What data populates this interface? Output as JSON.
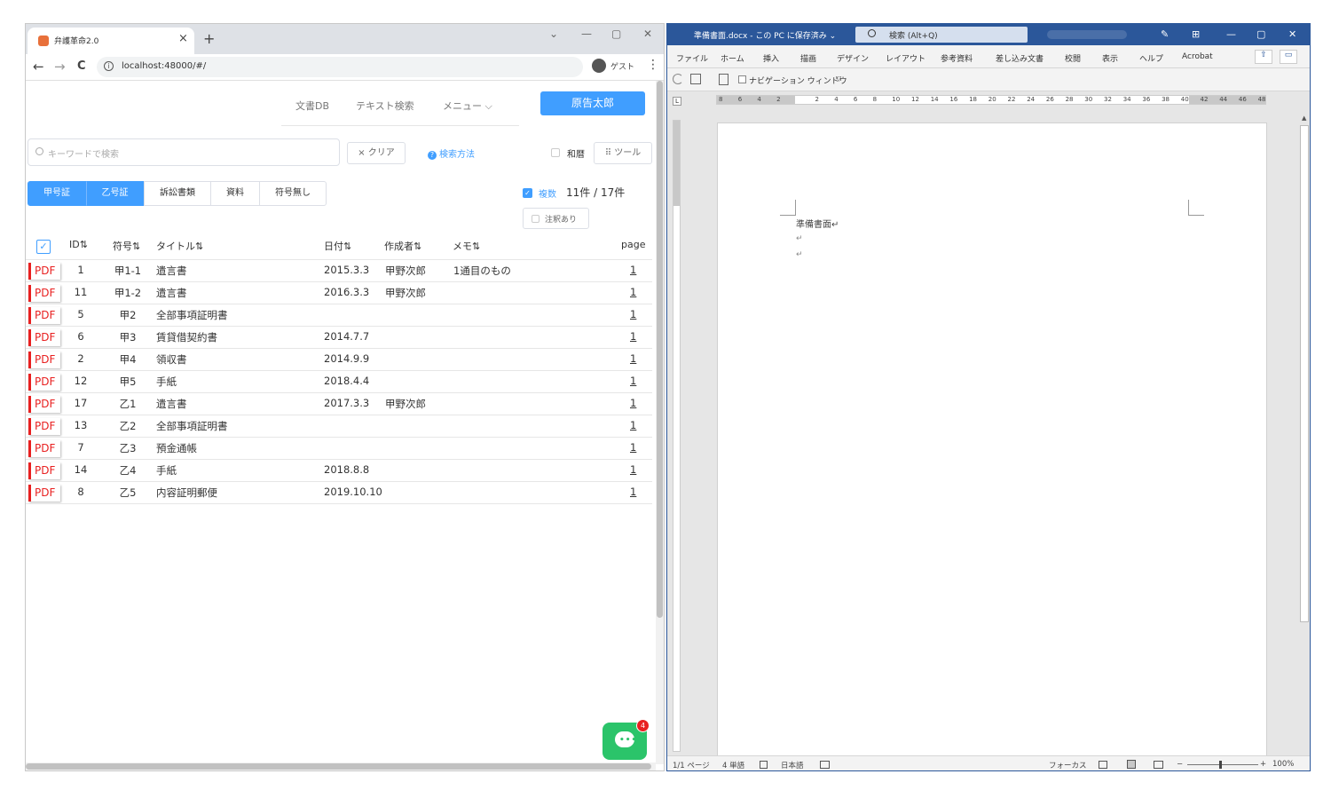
{
  "browser": {
    "tab_title": "弁護革命2.0",
    "url": "localhost:48000/#/",
    "profile_label": "ゲスト",
    "tab_close": "×",
    "new_tab": "+",
    "back": "←",
    "forward": "→",
    "reload": "C",
    "kebab": "⋮",
    "win_controls": [
      "⌄",
      "—",
      "▢",
      "✕"
    ]
  },
  "app": {
    "nav": [
      "文書DB",
      "テキスト検索",
      "メニュー ⌵"
    ],
    "user_button": "原告太郎",
    "search_placeholder": "キーワードで検索",
    "clear_label": "× クリア",
    "help_label": "検索方法",
    "wareki_label": "和暦",
    "tool_label": "⠿ ツール",
    "categories": [
      "甲号証",
      "乙号証",
      "訴訟書類",
      "資料",
      "符号無し"
    ],
    "multi_label": "複数",
    "count_label": "11件 / 17件",
    "note_label": "注釈あり",
    "chat_badge": "4",
    "table": {
      "headers": [
        "ID⇅",
        "符号⇅",
        "タイトル⇅",
        "日付⇅",
        "作成者⇅",
        "メモ⇅",
        "page"
      ],
      "pdf_label": "PDF",
      "rows": [
        {
          "id": "1",
          "code": "甲1-1",
          "title": "遺言書",
          "date": "2015.3.3",
          "author": "甲野次郎",
          "memo": "1通目のもの",
          "page": "1"
        },
        {
          "id": "11",
          "code": "甲1-2",
          "title": "遺言書",
          "date": "2016.3.3",
          "author": "甲野次郎",
          "memo": "",
          "page": "1"
        },
        {
          "id": "5",
          "code": "甲2",
          "title": "全部事項証明書",
          "date": "",
          "author": "",
          "memo": "",
          "page": "1"
        },
        {
          "id": "6",
          "code": "甲3",
          "title": "賃貸借契約書",
          "date": "2014.7.7",
          "author": "",
          "memo": "",
          "page": "1"
        },
        {
          "id": "2",
          "code": "甲4",
          "title": "領収書",
          "date": "2014.9.9",
          "author": "",
          "memo": "",
          "page": "1"
        },
        {
          "id": "12",
          "code": "甲5",
          "title": "手紙",
          "date": "2018.4.4",
          "author": "",
          "memo": "",
          "page": "1"
        },
        {
          "id": "17",
          "code": "乙1",
          "title": "遺言書",
          "date": "2017.3.3",
          "author": "甲野次郎",
          "memo": "",
          "page": "1"
        },
        {
          "id": "13",
          "code": "乙2",
          "title": "全部事項証明書",
          "date": "",
          "author": "",
          "memo": "",
          "page": "1"
        },
        {
          "id": "7",
          "code": "乙3",
          "title": "預金通帳",
          "date": "",
          "author": "",
          "memo": "",
          "page": "1"
        },
        {
          "id": "14",
          "code": "乙4",
          "title": "手紙",
          "date": "2018.8.8",
          "author": "",
          "memo": "",
          "page": "1"
        },
        {
          "id": "8",
          "code": "乙5",
          "title": "内容証明郵便",
          "date": "2019.10.10",
          "author": "",
          "memo": "",
          "page": "1"
        }
      ]
    }
  },
  "word": {
    "doc_title": "準備書面.docx - この PC に保存済み ⌄",
    "search_label": "検索 (Alt+Q)",
    "title_controls": [
      "✎",
      "⊞",
      "—",
      "▢",
      "✕"
    ],
    "ribbon_tabs": [
      "ファイル",
      "ホーム",
      "挿入",
      "描画",
      "デザイン",
      "レイアウト",
      "参考資料",
      "差し込み文書",
      "校閲",
      "表示",
      "ヘルプ",
      "Acrobat"
    ],
    "navpane_label": "ナビゲーション ウィンドウ",
    "ruler_numbers": [
      "8",
      "6",
      "4",
      "2",
      "",
      "2",
      "4",
      "6",
      "8",
      "10",
      "12",
      "14",
      "16",
      "18",
      "20",
      "22",
      "24",
      "26",
      "28",
      "30",
      "32",
      "34",
      "36",
      "38",
      "40",
      "42",
      "44",
      "46",
      "48"
    ],
    "doc_text": "準備書面↵",
    "para_mark": "↵",
    "status": {
      "page": "1/1 ページ",
      "words": "4 単語",
      "language": "日本語",
      "focus": "フォーカス",
      "zoom": "100%",
      "zoom_minus": "−",
      "zoom_plus": "+"
    }
  }
}
